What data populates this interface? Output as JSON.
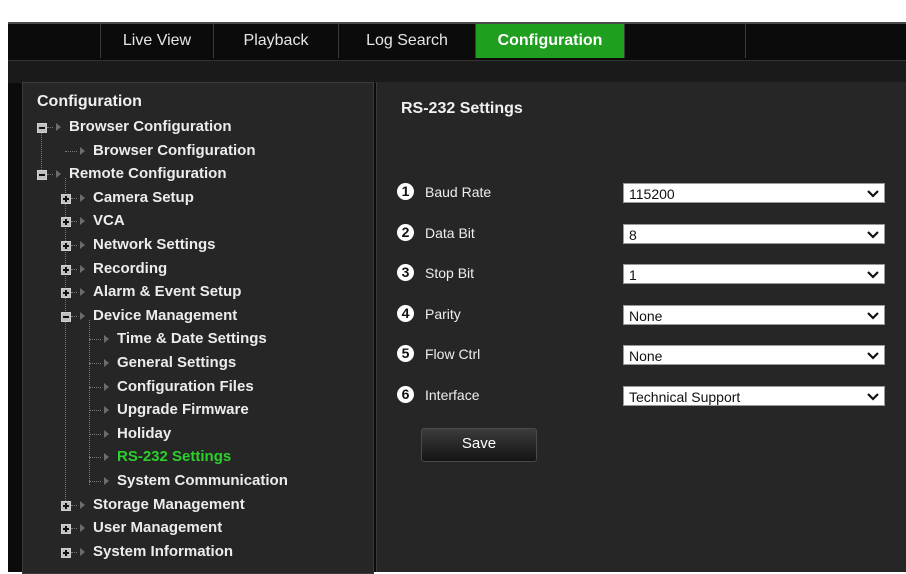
{
  "tabs": [
    "Live View",
    "Playback",
    "Log Search",
    "Configuration"
  ],
  "sidebar": {
    "title": "Configuration",
    "tree": [
      "Browser Configuration",
      "Browser Configuration",
      "Remote Configuration",
      "Camera Setup",
      "VCA",
      "Network Settings",
      "Recording",
      "Alarm & Event Setup",
      "Device Management",
      "Time & Date Settings",
      "General Settings",
      "Configuration Files",
      "Upgrade Firmware",
      "Holiday",
      "RS-232 Settings",
      "System Communication",
      "Storage Management",
      "User Management",
      "System Information"
    ],
    "selected": "RS-232 Settings"
  },
  "main": {
    "title": "RS-232 Settings",
    "fields": [
      {
        "num": "1",
        "label": "Baud Rate",
        "value": "115200"
      },
      {
        "num": "2",
        "label": "Data Bit",
        "value": "8"
      },
      {
        "num": "3",
        "label": "Stop Bit",
        "value": "1"
      },
      {
        "num": "4",
        "label": "Parity",
        "value": "None"
      },
      {
        "num": "5",
        "label": "Flow Ctrl",
        "value": "None"
      },
      {
        "num": "6",
        "label": "Interface",
        "value": "Technical Support"
      }
    ],
    "save_label": "Save"
  },
  "colors": {
    "accent": "#1f9e1f",
    "selected_text": "#2bd02b",
    "panel": "#262626",
    "background": "#0b0b0b"
  },
  "icons": {
    "expand": "plus-box-icon",
    "collapse": "minus-box-icon",
    "node": "triangle-right-icon",
    "dropdown": "chevron-down-icon"
  }
}
